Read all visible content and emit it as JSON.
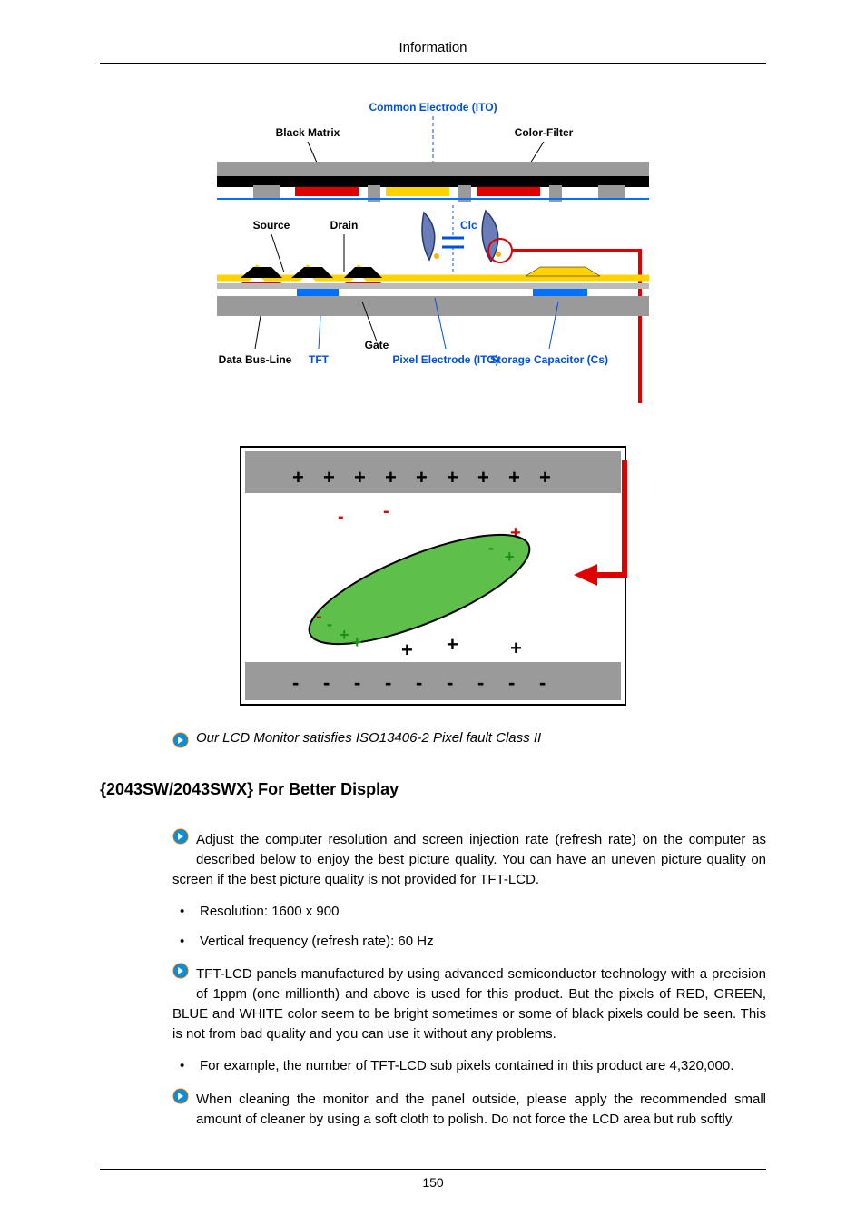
{
  "header": {
    "title": "Information"
  },
  "figure": {
    "labels": {
      "common_electrode": "Common Electrode (ITO)",
      "black_matrix": "Black Matrix",
      "color_filter": "Color-Filter",
      "source": "Source",
      "drain": "Drain",
      "clc": "Clc",
      "data_bus_line": "Data Bus-Line",
      "tft": "TFT",
      "gate": "Gate",
      "pixel_electrode": "Pixel Electrode (ITO)",
      "storage_capacitor": "Storage Capacitor (Cs)"
    }
  },
  "note": "Our LCD Monitor satisfies ISO13406-2 Pixel fault Class II",
  "section_heading": "{2043SW/2043SWX} For Better Display",
  "paragraphs": {
    "p1": "Adjust the computer resolution and screen injection rate (refresh rate) on the computer as described below to enjoy the best picture quality. You can have an uneven picture quality on screen if the best picture quality is not provided for TFT-LCD.",
    "resolution_item": "Resolution: 1600 x 900",
    "refresh_item": "Vertical frequency (refresh rate): 60 Hz",
    "p2": "TFT-LCD panels manufactured by using advanced semiconductor technology with a precision of 1ppm (one millionth) and above is used for this product. But the pixels of RED, GREEN, BLUE and WHITE color seem to be bright sometimes or some of black pixels could be seen. This is not from bad quality and you can use it without any problems.",
    "example_item": "For example, the number of TFT-LCD sub pixels contained in this product are 4,320,000.",
    "p3": "When cleaning the monitor and the panel outside, please apply the recommended small amount of cleaner by using a soft cloth to polish. Do not force the LCD area but rub softly."
  },
  "footer": {
    "page_number": "150"
  }
}
